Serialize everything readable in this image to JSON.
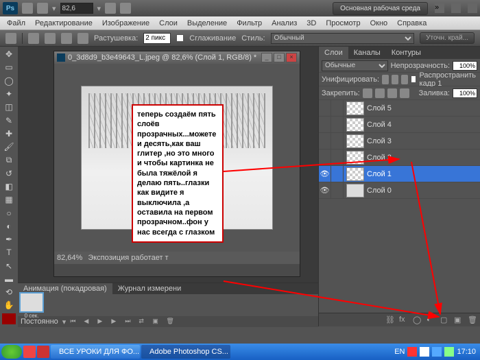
{
  "topbar": {
    "zoom": "82,6",
    "work_env": "Основная рабочая среда"
  },
  "menu": [
    "Файл",
    "Редактирование",
    "Изображение",
    "Слои",
    "Выделение",
    "Фильтр",
    "Анализ",
    "3D",
    "Просмотр",
    "Окно",
    "Справка"
  ],
  "options": {
    "feather_label": "Растушевка:",
    "feather_value": "2 пикс",
    "antialias": "Сглаживание",
    "style_label": "Стиль:",
    "style_value": "Обычный",
    "refine": "Уточн. край..."
  },
  "doc": {
    "title": "0_3d8d9_b3e49643_L.jpeg @ 82,6% (Слой 1, RGB/8) *",
    "zoom": "82,64%",
    "status": "Экспозиция работает т"
  },
  "anim": {
    "tab1": "Анимация (покадровая)",
    "tab2": "Журнал измерени",
    "frame_time": "0 сек.",
    "loop": "Постоянно"
  },
  "layers_panel": {
    "tabs": [
      "Слои",
      "Каналы",
      "Контуры"
    ],
    "mode": "Обычные",
    "opacity_label": "Непрозрачность:",
    "opacity": "100%",
    "unify": "Унифицировать:",
    "propagate": "Распространить кадр 1",
    "lock_label": "Закрепить:",
    "fill_label": "Заливка:",
    "fill": "100%",
    "layers": [
      {
        "name": "Слой 5",
        "eye": false,
        "sel": false,
        "bg": false
      },
      {
        "name": "Слой 4",
        "eye": false,
        "sel": false,
        "bg": false
      },
      {
        "name": "Слой 3",
        "eye": false,
        "sel": false,
        "bg": false
      },
      {
        "name": "Слой 2",
        "eye": false,
        "sel": false,
        "bg": false
      },
      {
        "name": "Слой 1",
        "eye": true,
        "sel": true,
        "bg": false
      },
      {
        "name": "Слой 0",
        "eye": true,
        "sel": false,
        "bg": true
      }
    ]
  },
  "annotation": "теперь создаём пять слоёв прозрачных...можете и десять,как ваш глитер ,но это много и чтобы картинка не была тяжёлой я делаю пять..глазки как видите я выключила ,а оставила на первом прозрачном..фон у нас всегда с глазком",
  "taskbar": {
    "items": [
      "ВСЕ УРОКИ ДЛЯ ФО...",
      "Adobe Photoshop CS..."
    ],
    "lang": "EN",
    "time": "17:10"
  }
}
